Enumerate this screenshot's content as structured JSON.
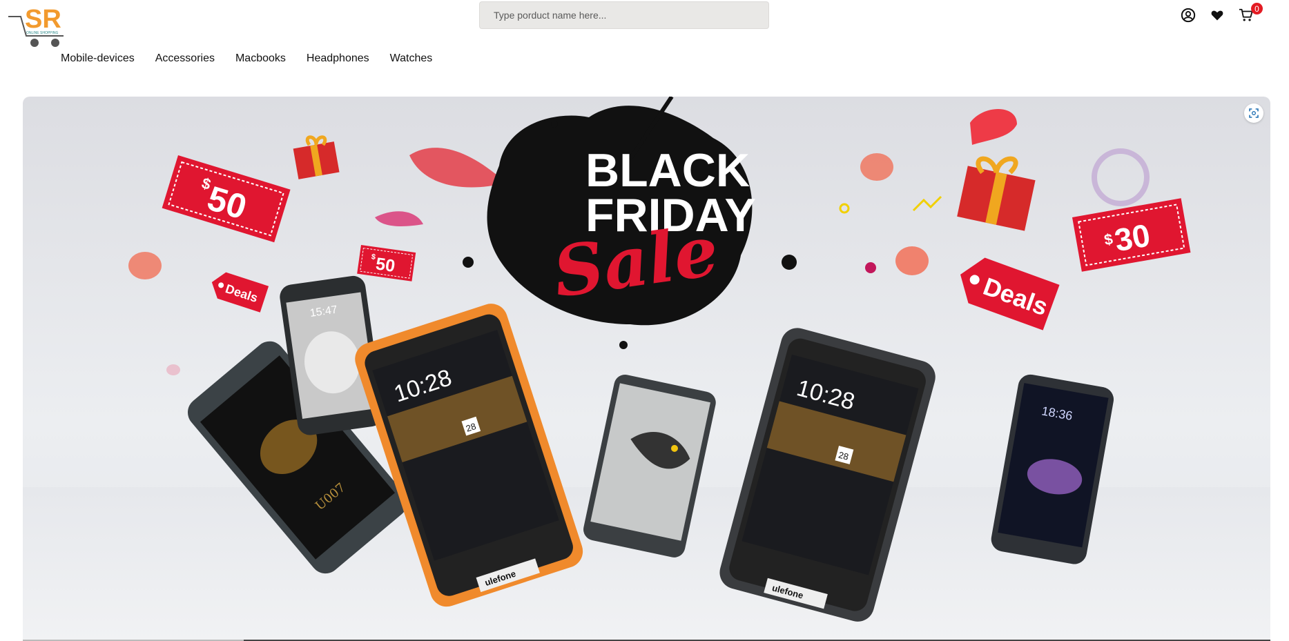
{
  "logo": {
    "letters": "SR",
    "tagline": "ONLINE SHOPPING"
  },
  "search": {
    "placeholder": "Type porduct name here..."
  },
  "header_icons": {
    "account": "user-circle-icon",
    "wishlist": "heart-icon",
    "cart": "cart-icon",
    "cart_count": "0"
  },
  "nav": {
    "items": [
      {
        "label": "Mobile-devices"
      },
      {
        "label": "Accessories"
      },
      {
        "label": "Macbooks"
      },
      {
        "label": "Headphones"
      },
      {
        "label": "Watches"
      }
    ]
  },
  "banner": {
    "headline_line1": "BLACK",
    "headline_line2": "FRIDAY",
    "headline_script": "Sale",
    "tag_50_large": "50",
    "tag_50_small": "50",
    "tag_30": "30",
    "currency": "$",
    "deals_small": "Deals",
    "deals_large": "Deals",
    "phone_time_1": "10:28",
    "phone_time_2": "10:28",
    "phone_time_3": "18:36",
    "phone_time_4": "15:47",
    "phone_date": "28",
    "phone_brand": "ulefone",
    "phone_model": "U007",
    "fullscreen_icon": "fullscreen-scan-icon",
    "colors": {
      "sale_red": "#e01630",
      "splash": "#111111",
      "orange_phone": "#f08a2c"
    }
  }
}
